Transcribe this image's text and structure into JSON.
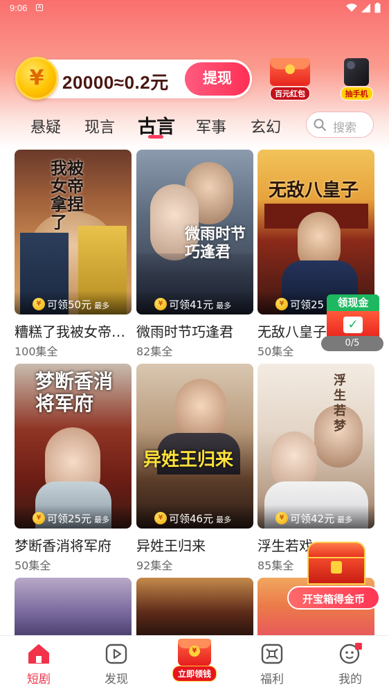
{
  "status_bar": {
    "time": "9:06",
    "notif_icon": "A"
  },
  "banner": {
    "coin_symbol": "¥",
    "coin_text": "20000≈0.2元",
    "withdraw_label": "提现",
    "promos": [
      {
        "label": "百元红包",
        "icon": "red-packet-icon"
      },
      {
        "label": "抽手机",
        "icon": "phone-icon"
      }
    ]
  },
  "tabs": [
    {
      "label": "悬疑",
      "active": false
    },
    {
      "label": "现言",
      "active": false
    },
    {
      "label": "古言",
      "active": true
    },
    {
      "label": "军事",
      "active": false
    },
    {
      "label": "玄幻",
      "active": false
    }
  ],
  "search": {
    "placeholder": "搜索"
  },
  "dramas": [
    {
      "title": "糟糕了我被女帝…",
      "episodes": "100集全",
      "reward": "可领50元",
      "reward_max": "最多",
      "art": "我被女帝拿捏了"
    },
    {
      "title": "微雨时节巧逢君",
      "episodes": "82集全",
      "reward": "可领41元",
      "reward_max": "最多",
      "art": "微雨时节巧逢君"
    },
    {
      "title": "无敌八皇子",
      "episodes": "50集全",
      "reward": "可领25",
      "reward_max": "",
      "art": "无敌八皇子"
    },
    {
      "title": "梦断香消将军府",
      "episodes": "50集全",
      "reward": "可领25元",
      "reward_max": "最多",
      "art": "梦断香消将军府"
    },
    {
      "title": "异姓王归来",
      "episodes": "92集全",
      "reward": "可领46元",
      "reward_max": "最多",
      "art": "异姓王归来"
    },
    {
      "title": "浮生若戏",
      "episodes": "85集全",
      "reward": "可领42元",
      "reward_max": "最多",
      "art": "浮生若梦"
    }
  ],
  "floating": {
    "cash_title": "领现金",
    "cash_progress": "0/5",
    "chest_label": "开宝箱得金币"
  },
  "bottom_nav": [
    {
      "label": "短剧",
      "active": true
    },
    {
      "label": "发现",
      "active": false
    },
    {
      "label": "立即领钱",
      "active": false
    },
    {
      "label": "福利",
      "active": false
    },
    {
      "label": "我的",
      "active": false
    }
  ],
  "colors": {
    "accent": "#f1324a",
    "banner_top": "#fa6f6e",
    "withdraw": "#ff2f55",
    "cash_green": "#1db860"
  }
}
